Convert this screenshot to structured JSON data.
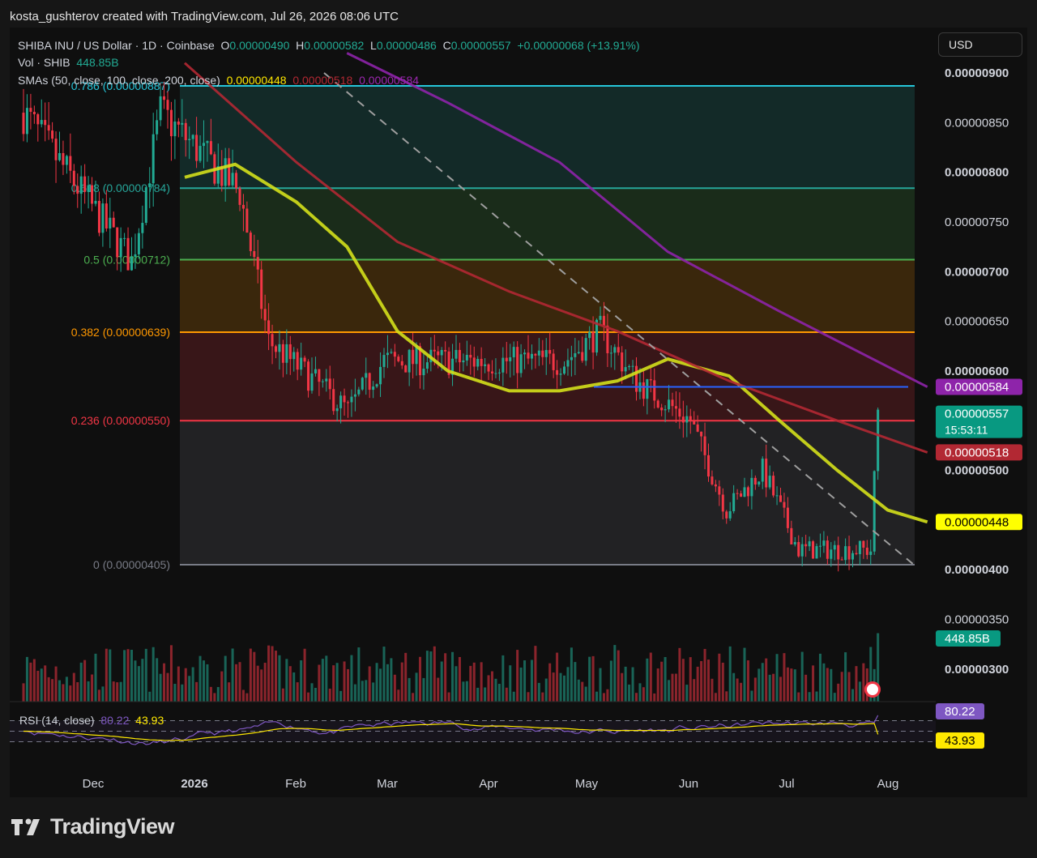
{
  "header": {
    "attribution": "kosta_gushterov created with TradingView.com, Jul 26, 2026 08:06 UTC"
  },
  "legend": {
    "symbol": "SHIBA INU / US Dollar · 1D · Coinbase",
    "o_label": "O",
    "o_value": "0.00000490",
    "h_label": "H",
    "h_value": "0.00000582",
    "l_label": "L",
    "l_value": "0.00000486",
    "c_label": "C",
    "c_value": "0.00000557",
    "change": "+0.00000068 (+13.91%)",
    "vol_label": "Vol · SHIB",
    "vol_value": "448.85B",
    "sma_label": "SMAs (50, close, 100, close, 200, close)",
    "sma50": "0.00000448",
    "sma100": "0.00000518",
    "sma200": "0.00000584",
    "rsi_label": "RSI (14, close)",
    "rsi_value": "80.22",
    "rsi_ma": "43.93"
  },
  "currency_button": "USD",
  "brand": "TradingView",
  "colors": {
    "up": "#22ab94",
    "down": "#f23645",
    "sma50": "#d4e01b",
    "sma100": "#b22833",
    "sma200": "#8e24aa",
    "rsi": "#7e57c2",
    "rsi_ma": "#ffe900",
    "resistance": "#2962ff"
  },
  "chart_data": {
    "type": "candlestick",
    "x_ticks": [
      "Dec",
      "2026",
      "Feb",
      "Mar",
      "Apr",
      "May",
      "Jun",
      "Jul",
      "Aug"
    ],
    "y_ticks": [
      "0.00000900",
      "0.00000850",
      "0.00000800",
      "0.00000750",
      "0.00000700",
      "0.00000650",
      "0.00000600",
      "0.00000500",
      "0.00000400",
      "0.00000350",
      "0.00000300"
    ],
    "ylim": [
      2.7e-06,
      9.2e-06
    ],
    "fib_levels": [
      {
        "label": "0.786 (0.00000887)",
        "ratio": 0.786,
        "price": 8.87e-06,
        "color": "#26c6da"
      },
      {
        "label": "0.618 (0.00000784)",
        "ratio": 0.618,
        "price": 7.84e-06,
        "color": "#26a69a"
      },
      {
        "label": "0.5 (0.00000712)",
        "ratio": 0.5,
        "price": 7.12e-06,
        "color": "#4caf50"
      },
      {
        "label": "0.382 (0.00000639)",
        "ratio": 0.382,
        "price": 6.39e-06,
        "color": "#ff9800"
      },
      {
        "label": "0.236 (0.00000550)",
        "ratio": 0.236,
        "price": 5.5e-06,
        "color": "#f23645"
      },
      {
        "label": "0 (0.00000405)",
        "ratio": 0,
        "price": 4.05e-06,
        "color": "#787b86"
      }
    ],
    "price_badges": [
      {
        "text": "0.00000584",
        "price": 5.84e-06,
        "color": "#8e24aa"
      },
      {
        "text": "0.00000557",
        "sub": "15:53:11",
        "price": 5.57e-06,
        "color": "#089981"
      },
      {
        "text": "0.00000518",
        "price": 5.18e-06,
        "color": "#b22833"
      },
      {
        "text": "0.00000448",
        "price": 4.48e-06,
        "color": "#ffff00",
        "textcolor": "#000"
      }
    ],
    "volume_badge": "448.85B",
    "rsi_badges": [
      {
        "text": "80.22",
        "value": 80.22,
        "color": "#7e57c2"
      },
      {
        "text": "43.93",
        "value": 43.93,
        "color": "#ffe900",
        "textcolor": "#000"
      }
    ],
    "resistance_price": 5.84e-06,
    "rsi_bands": [
      70,
      50,
      30
    ],
    "series": [
      {
        "name": "SMA 50",
        "values": [
          {
            "x": "2026-01-01",
            "y": 7.95e-06
          },
          {
            "x": "2026-01-15",
            "y": 8.08e-06
          },
          {
            "x": "2026-02-01",
            "y": 7.7e-06
          },
          {
            "x": "2026-02-15",
            "y": 7.25e-06
          },
          {
            "x": "2026-03-01",
            "y": 6.4e-06
          },
          {
            "x": "2026-03-15",
            "y": 6e-06
          },
          {
            "x": "2026-04-01",
            "y": 5.8e-06
          },
          {
            "x": "2026-04-15",
            "y": 5.8e-06
          },
          {
            "x": "2026-05-01",
            "y": 5.9e-06
          },
          {
            "x": "2026-05-15",
            "y": 6.12e-06
          },
          {
            "x": "2026-06-01",
            "y": 5.95e-06
          },
          {
            "x": "2026-06-15",
            "y": 5.5e-06
          },
          {
            "x": "2026-07-01",
            "y": 5e-06
          },
          {
            "x": "2026-07-15",
            "y": 4.6e-06
          },
          {
            "x": "2026-07-26",
            "y": 4.48e-06
          }
        ]
      },
      {
        "name": "SMA 100",
        "values": [
          {
            "x": "2026-01-01",
            "y": 9.1e-06
          },
          {
            "x": "2026-02-01",
            "y": 8.1e-06
          },
          {
            "x": "2026-03-01",
            "y": 7.3e-06
          },
          {
            "x": "2026-04-01",
            "y": 6.8e-06
          },
          {
            "x": "2026-05-01",
            "y": 6.4e-06
          },
          {
            "x": "2026-06-01",
            "y": 5.9e-06
          },
          {
            "x": "2026-07-01",
            "y": 5.5e-06
          },
          {
            "x": "2026-07-26",
            "y": 5.18e-06
          }
        ]
      },
      {
        "name": "SMA 200",
        "values": [
          {
            "x": "2026-02-15",
            "y": 9.2e-06
          },
          {
            "x": "2026-03-15",
            "y": 8.7e-06
          },
          {
            "x": "2026-04-15",
            "y": 8.1e-06
          },
          {
            "x": "2026-05-15",
            "y": 7.2e-06
          },
          {
            "x": "2026-06-15",
            "y": 6.6e-06
          },
          {
            "x": "2026-07-26",
            "y": 5.84e-06
          }
        ]
      }
    ]
  }
}
